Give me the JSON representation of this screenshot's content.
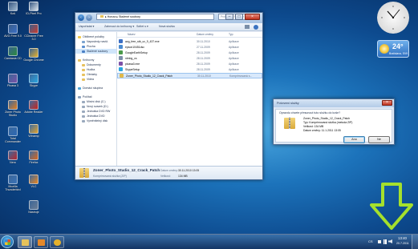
{
  "desktop": {
    "icons": [
      {
        "label": "Koš",
        "color": "#9fb7cf"
      },
      {
        "label": "ID-Pixel Pro",
        "color": "#d9e1ea"
      },
      {
        "label": "AVG Free 9.0",
        "color": "#3b6fc4"
      },
      {
        "label": "CCleaner Free 3.0",
        "color": "#cc3a2c"
      },
      {
        "label": "Camtasia CD",
        "color": "#2a8a3c"
      },
      {
        "label": "Google Chrome",
        "color": "#e5b12b"
      },
      {
        "label": "Picasa 3",
        "color": "#7d52a8"
      },
      {
        "label": "Skype",
        "color": "#29a6e0"
      },
      {
        "label": "Zoner Photo Studio",
        "color": "#e07d1f"
      },
      {
        "label": "Adobe Reader",
        "color": "#c8241b"
      },
      {
        "label": "Total Commander",
        "color": "#2c68b3"
      },
      {
        "label": "Winamp",
        "color": "#e0a02a"
      },
      {
        "label": "Nero",
        "color": "#b8272d"
      },
      {
        "label": "Firefox",
        "color": "#d9661c"
      },
      {
        "label": "Mozilla Thunderbird",
        "color": "#3b73b8"
      },
      {
        "label": "VLC",
        "color": "#e9851f"
      },
      {
        "label": "Nástroje",
        "color": "#6b7d94"
      }
    ]
  },
  "explorer": {
    "breadcrumb": "▸ Honza ▸ Stažené soubory",
    "search_placeholder": "Prohledat: Stažené soubory",
    "toolbar": {
      "organize": "Uspořádat ▾",
      "include": "Zahrnout do knihovny ▾",
      "share": "Sdílet s ▾",
      "new_folder": "Nová složka"
    },
    "nav": {
      "favorites": [
        {
          "label": "Oblíbené položky",
          "sel": false,
          "color": "#f2c94c"
        },
        {
          "label": "Naposledy navšt.",
          "sel": false,
          "color": "#7aa3cf"
        },
        {
          "label": "Plocha",
          "sel": false,
          "color": "#5b8fd0"
        },
        {
          "label": "Stažené soubory",
          "sel": true,
          "color": "#4a7fc4"
        }
      ],
      "libraries": [
        {
          "label": "Knihovny",
          "color": "#e7c15e"
        },
        {
          "label": "Dokumenty",
          "color": "#e7c15e"
        },
        {
          "label": "Hudba",
          "color": "#e7c15e"
        },
        {
          "label": "Obrázky",
          "color": "#e7c15e"
        },
        {
          "label": "Videa",
          "color": "#e7c15e"
        }
      ],
      "homegroup": [
        {
          "label": "Domácí skupina",
          "color": "#4da5d8"
        }
      ],
      "computer": [
        {
          "label": "Počítač",
          "color": "#8ea3bd"
        },
        {
          "label": "Místní disk (C:)",
          "color": "#9aa9bd"
        },
        {
          "label": "Nový svazek (D:)",
          "color": "#9aa9bd"
        },
        {
          "label": "Jednotka DVD RW",
          "color": "#9aa9bd"
        },
        {
          "label": "Jednotka DVD",
          "color": "#9aa9bd"
        },
        {
          "label": "Vyměnitelný disk",
          "color": "#9aa9bd"
        }
      ]
    },
    "columns": [
      "Název",
      "Datum změny",
      "Typ"
    ],
    "files": [
      {
        "name": "avg_free_stb_cz_9_437.exe",
        "date": "30.11.2010",
        "type": "Aplikace",
        "color": "#3b6fc4",
        "sel": false
      },
      {
        "name": "epson10451dsc",
        "date": "27.11.2009",
        "type": "Aplikace",
        "color": "#4a8bd0",
        "sel": false
      },
      {
        "name": "GoogleEarthSetup",
        "date": "28.11.2009",
        "type": "Aplikace",
        "color": "#4b9a4b",
        "sel": false
      },
      {
        "name": "nlmbg_cs",
        "date": "28.11.2009",
        "type": "Aplikace",
        "color": "#7b8ea8",
        "sel": false
      },
      {
        "name": "picasa3.exe",
        "date": "28.11.2009",
        "type": "Aplikace",
        "color": "#7d52a8",
        "sel": false
      },
      {
        "name": "SkypeSetup",
        "date": "28.11.2009",
        "type": "Aplikace",
        "color": "#29a6e0",
        "sel": false
      },
      {
        "name": "Zoner_Photo_Studio_12_Crack_Patch",
        "date": "30.11.2010",
        "type": "Komprimovaná s...",
        "color": "#e0b84a",
        "sel": true
      }
    ],
    "details": {
      "name": "Zoner_Photo_Studio_12_Crack_Patch",
      "type": "Komprimovaná složka (ZIP)",
      "date_label": "Datum změny:",
      "date_value": "30.11.2010 13:05",
      "size_label": "Velikost:",
      "size_value": "134 MB"
    }
  },
  "dialog": {
    "title": "Potvrzení složky",
    "message": "Opravdu chcete přesunout tuto složku do koše?",
    "item_name": "Zoner_Photo_Studio_12_Crack_Patch",
    "item_type": "Typ: Komprimovaná složka (metoda ZIP)",
    "item_size": "Velikost: 134 MB",
    "item_date": "Datum změny: 11.1.2011 13:05",
    "yes_label": "Ano",
    "no_label": "Ne"
  },
  "gadgets": {
    "weather_temp": "24°",
    "weather_city": "Bratislava, SVK"
  },
  "taskbar": {
    "lang": "CS",
    "time": "13:40",
    "date": "20.7.2011",
    "pinned": [
      {
        "name": "explorer",
        "color": "#e6c25a"
      },
      {
        "name": "media-player",
        "color": "#e4882a"
      },
      {
        "name": "chrome",
        "color": "#e5b12b"
      }
    ]
  },
  "colors": {
    "arrow": "#a5e02c",
    "accent": "#4a7fc4"
  }
}
